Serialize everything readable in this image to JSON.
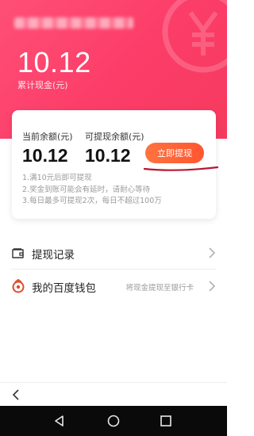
{
  "header": {
    "total_amount": "10.12",
    "total_label": "累计现金(元)",
    "username_icon": "blurred-username",
    "watermark_icon": "yuan-coin-icon",
    "gradient_colors": [
      "#ff4f76",
      "#f63a5e"
    ]
  },
  "balance_card": {
    "current_label": "当前余额(元)",
    "current_value": "10.12",
    "withdrawable_label": "可提现余额(元)",
    "withdrawable_value": "10.12",
    "withdraw_button": "立即提现",
    "button_color": "#ff5a33",
    "rules": [
      "1.满10元后即可提现",
      "2.奖金到账可能会有延时，请耐心等待",
      "3.每日最多可提现2次，每日不超过100万"
    ]
  },
  "menu": [
    {
      "label": "提现记录",
      "hint": "",
      "icon": "wallet-icon"
    },
    {
      "label": "我的百度钱包",
      "hint": "将现金提现至银行卡",
      "icon": "baidu-wallet-icon"
    }
  ],
  "bottom": {
    "back_icon": "back-arrow-icon",
    "system_nav": [
      "back-triangle-icon",
      "home-circle-icon",
      "recents-square-icon"
    ]
  }
}
